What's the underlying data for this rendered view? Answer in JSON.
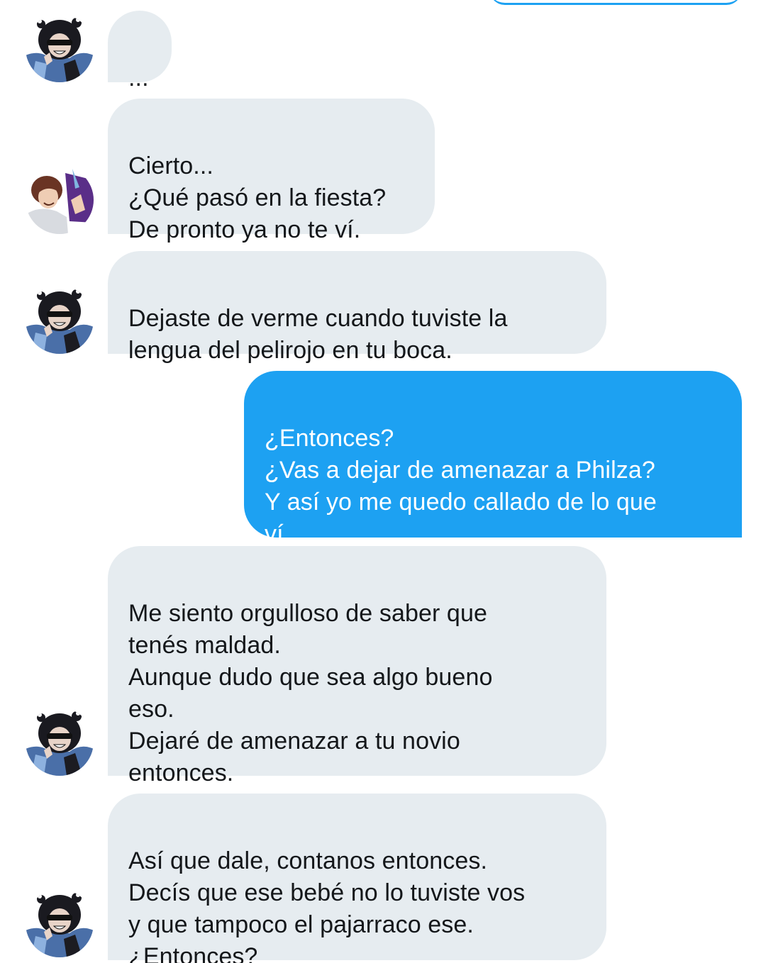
{
  "conversation": {
    "messages": [
      {
        "sender": "contact-dark-hair",
        "direction": "incoming",
        "text": "..."
      },
      {
        "sender": "contact-brown-hair",
        "direction": "incoming",
        "text": "Cierto...\n¿Qué pasó en la fiesta?\nDe pronto ya no te ví."
      },
      {
        "sender": "contact-dark-hair",
        "direction": "incoming",
        "text": "Dejaste de verme cuando tuviste la\nlengua del pelirojo en tu boca."
      },
      {
        "sender": "me",
        "direction": "outgoing",
        "text": "¿Entonces?\n¿Vas a dejar de amenazar a Philza?\nY así yo me quedo callado de lo que\nví."
      },
      {
        "sender": "contact-dark-hair",
        "direction": "incoming",
        "text": "Me siento orgulloso de saber que\ntenés maldad.\nAunque dudo que sea algo bueno\neso.\nDejaré de amenazar a tu novio\nentonces."
      },
      {
        "sender": "contact-dark-hair",
        "direction": "incoming",
        "text": "Así que dale, contanos entonces.\nDecís que ese bebé no lo tuviste vos\ny que tampoco el pajarraco ese.\n¿Entonces?"
      }
    ]
  },
  "colors": {
    "incoming_bubble": "#e6ecf0",
    "outgoing_bubble": "#1da1f2",
    "incoming_text": "#14171a",
    "outgoing_text": "#ffffff",
    "background": "#ffffff"
  },
  "icons": {
    "avatar_dark": "dark-haired-character-avatar-icon",
    "avatar_brown": "brown-haired-character-avatar-icon"
  }
}
